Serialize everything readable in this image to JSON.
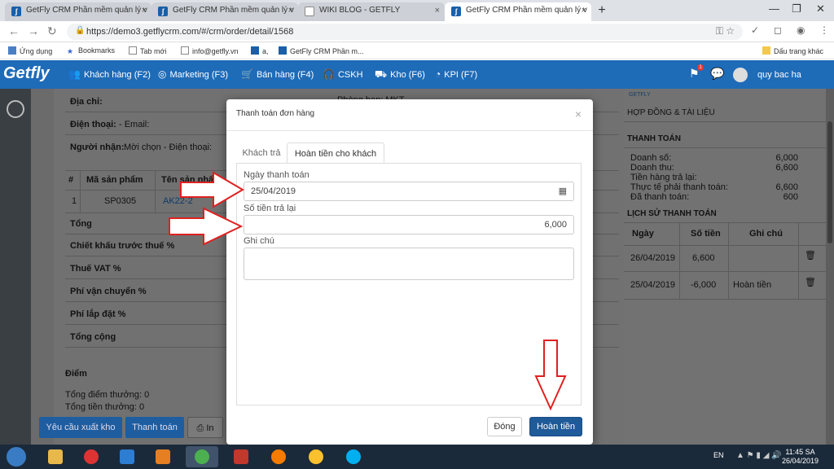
{
  "browser": {
    "tabs": [
      {
        "title": "GetFly CRM Phần mềm quản lý v",
        "active": false
      },
      {
        "title": "GetFly CRM Phần mềm quản lý v",
        "active": false
      },
      {
        "title": "WIKI BLOG - GETFLY",
        "active": false
      },
      {
        "title": "GetFly CRM Phần mềm quản lý v",
        "active": true
      }
    ],
    "url": "https://demo3.getflycrm.com/#/crm/order/detail/1568",
    "bookmarks": [
      "Ứng dụng",
      "Bookmarks",
      "Tab mới",
      "info@getfly.vn",
      "a,",
      "GetFly CRM Phần m..."
    ],
    "other_bookmarks": "Dấu trang khác"
  },
  "appnav": {
    "logo": "Getfly",
    "items": [
      "Khách hàng (F2)",
      "Marketing (F3)",
      "Bán hàng (F4)",
      "CSKH",
      "Kho (F6)",
      "KPI (F7)"
    ],
    "notification_count": "1",
    "user_name": "quy bac ha"
  },
  "order": {
    "address_label": "Địa chỉ:",
    "phone_label": "Điện thoại:",
    "email_label": "- Email:",
    "recipient_label": "Người nhận:",
    "recipient_value": "Mời chọn - Điện thoại:",
    "dept_label": "Phòng ban:",
    "dept_value": "MKT",
    "table_headers": [
      "#",
      "Mã sản phẩm",
      "Tên sản phẩm"
    ],
    "rows": [
      {
        "no": "1",
        "code": "SP0305",
        "name": "AK22-2"
      }
    ],
    "summary_labels": [
      "Tổng",
      "Chiết khấu trước thuế %",
      "Thuế VAT %",
      "Phí vận chuyển %",
      "Phí lắp đặt %",
      "Tổng cộng"
    ],
    "points_title": "Điểm",
    "points_lines": [
      "Tổng điểm thưởng: 0",
      "Tổng tiền thưởng: 0"
    ],
    "buttons": [
      "Yêu cầu xuất kho",
      "Thanh toán",
      "In"
    ]
  },
  "sidebar": {
    "brand": "GETFLY",
    "contracts_title": "HỢP ĐỒNG & TÀI LIỆU",
    "payment_title": "THANH TOÁN",
    "payment_rows": [
      {
        "label": "Doanh số:",
        "value": "6,000"
      },
      {
        "label": "Doanh thu:",
        "value": "6,600"
      },
      {
        "label": "Tiền hàng trả lại:",
        "value": ""
      },
      {
        "label": "Thực tế phải thanh toán:",
        "value": "6,600"
      },
      {
        "label": "Đã thanh toán:",
        "value": "600"
      }
    ],
    "history_title": "LỊCH SỬ THANH TOÁN",
    "history_headers": [
      "Ngày",
      "Số tiền",
      "Ghi chú"
    ],
    "history_rows": [
      {
        "date": "26/04/2019",
        "amount": "6,600",
        "note": ""
      },
      {
        "date": "25/04/2019",
        "amount": "-6,000",
        "note": "Hoàn tiền"
      }
    ]
  },
  "modal": {
    "title": "Thanh toán đơn hàng",
    "close_glyph": "×",
    "tabs": [
      "Khách trả",
      "Hoàn tiền cho khách"
    ],
    "date_label": "Ngày thanh toán",
    "date_value": "25/04/2019",
    "amount_label": "Số tiền trả lại",
    "amount_value": "6,000",
    "note_label": "Ghi chú",
    "close_button": "Đóng",
    "submit_button": "Hoàn tiền"
  },
  "taskbar": {
    "lang": "EN",
    "time": "11:45 SA",
    "date": "26/04/2019"
  },
  "colors": {
    "nav_blue": "#1e6bb8",
    "primary_button": "#1f5a99",
    "arrow_red": "#e02020"
  }
}
